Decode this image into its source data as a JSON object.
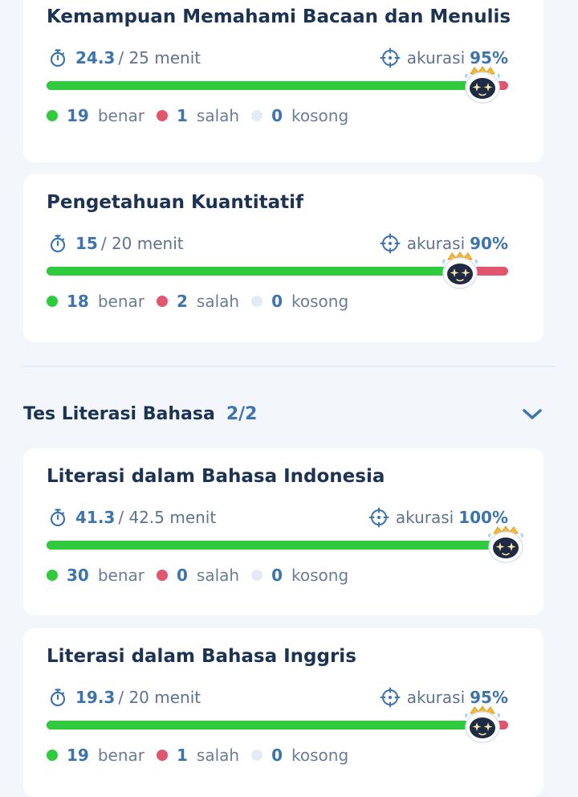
{
  "cards_top": [
    {
      "title": "Kemampuan Memahami Bacaan dan Menulis",
      "time_used": "24.3",
      "time_total": "/ 25 menit",
      "accuracy_label": "akurasi",
      "accuracy_value": "95%",
      "accuracy_fraction": 0.95,
      "benar_count": "19",
      "benar_label": "benar",
      "salah_count": "1",
      "salah_label": "salah",
      "kosong_count": "0",
      "kosong_label": "kosong"
    },
    {
      "title": "Pengetahuan Kuantitatif",
      "time_used": "15",
      "time_total": "/ 20 menit",
      "accuracy_label": "akurasi",
      "accuracy_value": "90%",
      "accuracy_fraction": 0.9,
      "benar_count": "18",
      "benar_label": "benar",
      "salah_count": "2",
      "salah_label": "salah",
      "kosong_count": "0",
      "kosong_label": "kosong"
    }
  ],
  "section": {
    "name": "Tes Literasi Bahasa",
    "count": "2/2"
  },
  "cards_bottom": [
    {
      "title": "Literasi dalam Bahasa Indonesia",
      "time_used": "41.3",
      "time_total": "/ 42.5 menit",
      "accuracy_label": "akurasi",
      "accuracy_value": "100%",
      "accuracy_fraction": 1.0,
      "benar_count": "30",
      "benar_label": "benar",
      "salah_count": "0",
      "salah_label": "salah",
      "kosong_count": "0",
      "kosong_label": "kosong"
    },
    {
      "title": "Literasi dalam Bahasa Inggris",
      "time_used": "19.3",
      "time_total": "/ 20 menit",
      "accuracy_label": "akurasi",
      "accuracy_value": "95%",
      "accuracy_fraction": 0.95,
      "benar_count": "19",
      "benar_label": "benar",
      "salah_count": "1",
      "salah_label": "salah",
      "kosong_count": "0",
      "kosong_label": "kosong"
    }
  ],
  "colors": {
    "correct": "#2fcb3d",
    "wrong": "#e2556e",
    "empty": "#e3ebf5",
    "accent": "#3d74ad"
  },
  "icons": {
    "timer": "stopwatch-icon",
    "accuracy": "crosshair-icon",
    "mascot": "robot-mascot-icon",
    "expand": "chevron-down-icon"
  }
}
